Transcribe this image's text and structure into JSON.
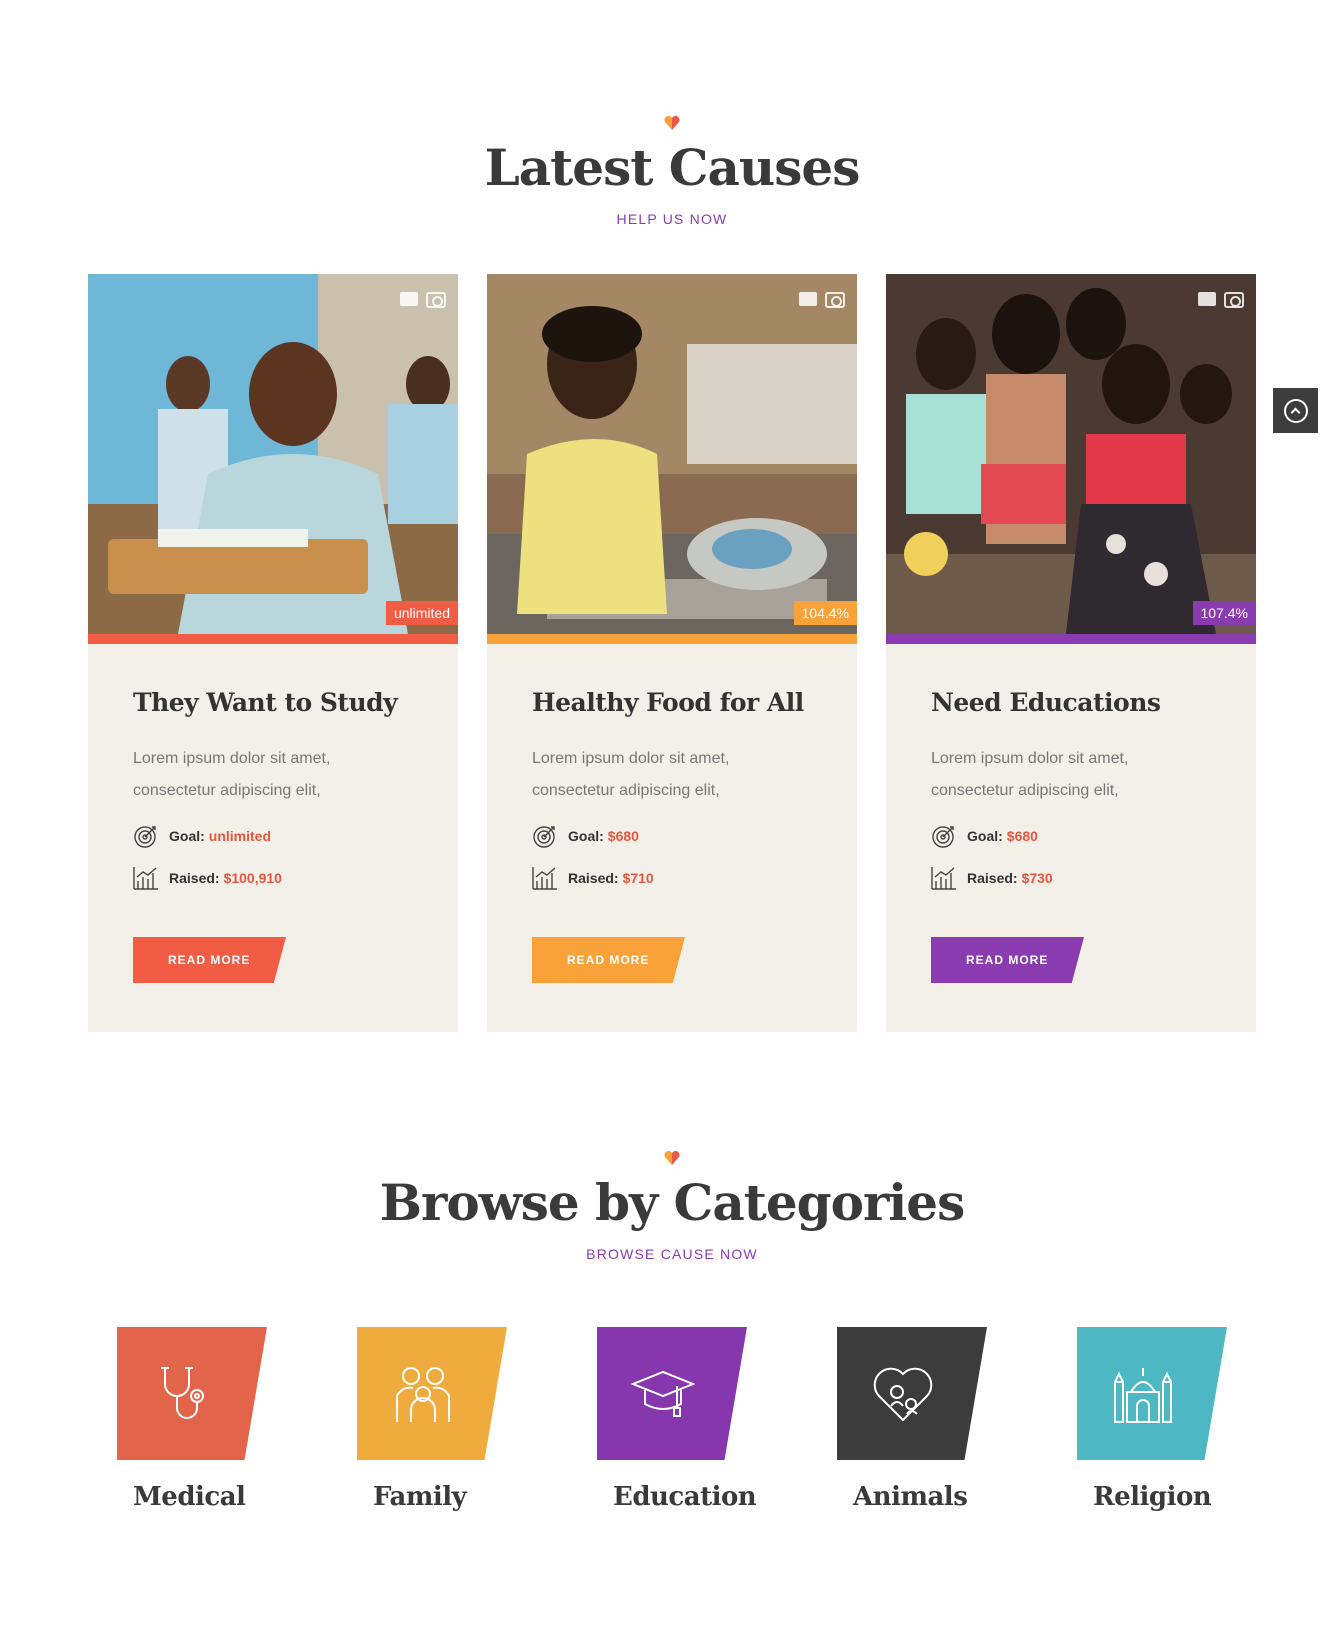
{
  "latest": {
    "title": "Latest Causes",
    "subtitle": "HELP US NOW"
  },
  "causes": [
    {
      "title": "They Want to Study",
      "description": "Lorem ipsum dolor sit amet, consectetur adipiscing elit,",
      "goal_label": "Goal:",
      "goal": "unlimited",
      "raised_label": "Raised:",
      "raised": "$100,910",
      "percent": "unlimited",
      "button": "READ MORE",
      "accent": "#f25c45"
    },
    {
      "title": "Healthy Food for All",
      "description": "Lorem ipsum dolor sit amet, consectetur adipiscing elit,",
      "goal_label": "Goal:",
      "goal": "$680",
      "raised_label": "Raised:",
      "raised": "$710",
      "percent": "104.4%",
      "button": "READ MORE",
      "accent": "#f9a23a"
    },
    {
      "title": "Need Educations",
      "description": "Lorem ipsum dolor sit amet, consectetur adipiscing elit,",
      "goal_label": "Goal:",
      "goal": "$680",
      "raised_label": "Raised:",
      "raised": "$730",
      "percent": "107.4%",
      "button": "READ MORE",
      "accent": "#8a3bb0"
    }
  ],
  "stat_value_color": "#e6563f",
  "browse": {
    "title": "Browse by Categories",
    "subtitle": "BROWSE CAUSE NOW"
  },
  "categories": [
    {
      "name": "Medical",
      "icon": "stethoscope-icon",
      "color": "#e2654b"
    },
    {
      "name": "Family",
      "icon": "family-icon",
      "color": "#f0ab3e"
    },
    {
      "name": "Education",
      "icon": "graduation-cap-icon",
      "color": "#8637ad"
    },
    {
      "name": "Animals",
      "icon": "pets-icon",
      "color": "#3c3c3c"
    },
    {
      "name": "Religion",
      "icon": "mosque-icon",
      "color": "#4db8c4"
    }
  ]
}
